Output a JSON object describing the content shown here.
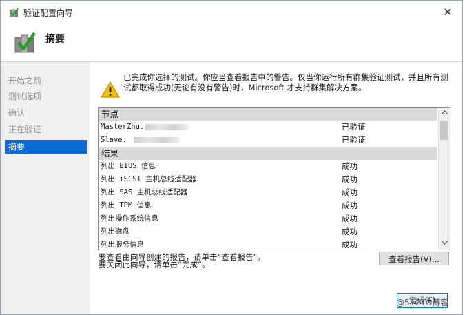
{
  "window": {
    "title": "验证配置向导",
    "header_title": "摘要",
    "close_glyph": "✕"
  },
  "sidebar": {
    "items": [
      {
        "label": "开始之前",
        "active": false
      },
      {
        "label": "测试选项",
        "active": false
      },
      {
        "label": "确认",
        "active": false
      },
      {
        "label": "正在验证",
        "active": false
      },
      {
        "label": "摘要",
        "active": true
      }
    ]
  },
  "summary": {
    "message": "已完成你选择的测试。你应当查看报告中的警告。仅当你运行所有群集验证测试，并且所有测试都取得成功(无论有没有警告)时，Microsoft 才支持群集解决方案。",
    "report": {
      "nodes_header": "节点",
      "nodes": [
        {
          "name": "MasterZhu.",
          "status": "已验证"
        },
        {
          "name": "Slave.",
          "status": "已验证"
        }
      ],
      "results_header": "结果",
      "results": [
        {
          "name": "列出 BIOS 信息",
          "status": "成功"
        },
        {
          "name": "列出 iSCSI 主机总线适配器",
          "status": "成功"
        },
        {
          "name": "列出 SAS 主机总线适配器",
          "status": "成功"
        },
        {
          "name": "列出 TPM 信息",
          "status": "成功"
        },
        {
          "name": "列出操作系统信息",
          "status": "成功"
        },
        {
          "name": "列出磁盘",
          "status": "成功"
        },
        {
          "name": "列出服务信息",
          "status": "成功"
        }
      ]
    },
    "note_line1": "要查看由向导创建的报告，请单击“查看报告”。",
    "note_line2": "要关闭此向导，请单击“完成”。",
    "view_report_label": "查看报告(V)...",
    "finish_label": "完成(F)"
  },
  "watermark": "@51CTO博客",
  "icons": {
    "app": "cluster-validate-icon",
    "header": "cluster-checkmark-icon",
    "warning": "warning-icon",
    "scroll_up": "chevron-up-icon",
    "scroll_down": "chevron-down-icon"
  },
  "colors": {
    "accent": "#0a6ad6",
    "group_header_bg": "#d9d9d9",
    "sidebar_bg": "#f0f0f0",
    "finish_border": "#0078d7"
  }
}
